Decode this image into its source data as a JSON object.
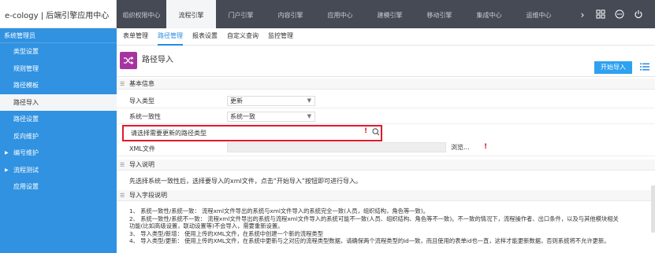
{
  "app": {
    "title": "e-cology | 后端引擎应用中心"
  },
  "top_tabs": [
    {
      "label": "组织权限中心",
      "active": false
    },
    {
      "label": "流程引擎",
      "active": true
    },
    {
      "label": "门户引擎",
      "active": false
    },
    {
      "label": "内容引擎",
      "active": false
    },
    {
      "label": "应用中心",
      "active": false
    },
    {
      "label": "建模引擎",
      "active": false
    },
    {
      "label": "移动引擎",
      "active": false
    },
    {
      "label": "集成中心",
      "active": false
    },
    {
      "label": "运维中心",
      "active": false
    }
  ],
  "top_icons": [
    "chevron-right-icon",
    "grid-icon",
    "dots-circle-icon",
    "power-icon"
  ],
  "sidebar": {
    "title": "系统管理员",
    "items": [
      {
        "label": "类型设置",
        "active": false,
        "expandable": false
      },
      {
        "label": "规则管理",
        "active": false,
        "expandable": false
      },
      {
        "label": "路径模板",
        "active": false,
        "expandable": false
      },
      {
        "label": "路径导入",
        "active": true,
        "expandable": false
      },
      {
        "label": "路径设置",
        "active": false,
        "expandable": false
      },
      {
        "label": "反向维护",
        "active": false,
        "expandable": false
      },
      {
        "label": "编号维护",
        "active": false,
        "expandable": true
      },
      {
        "label": "流程测试",
        "active": false,
        "expandable": true
      },
      {
        "label": "应用设置",
        "active": false,
        "expandable": false
      }
    ]
  },
  "subnav": [
    {
      "label": "表单管理",
      "active": false
    },
    {
      "label": "路径管理",
      "active": true
    },
    {
      "label": "报表设置",
      "active": false
    },
    {
      "label": "自定义查询",
      "active": false
    },
    {
      "label": "监控管理",
      "active": false
    }
  ],
  "page": {
    "title": "路径导入",
    "start_button": "开始导入"
  },
  "basic_info": {
    "header": "基本信息",
    "import_type": {
      "label": "导入类型",
      "value": "更新"
    },
    "consistency": {
      "label": "系统一致性",
      "value": "系统一致"
    },
    "path_type": {
      "label": "请选择需要更新的路径类型",
      "value": ""
    },
    "xml_file": {
      "label": "XML文件",
      "browse": "浏览..."
    }
  },
  "import_desc": {
    "header": "导入说明",
    "text": "先选择系统一致性后，选择要导入的xml文件，点击“开始导入”按钮即可进行导入。"
  },
  "field_desc": {
    "header": "导入字段说明",
    "lines": [
      "1、 系统一致性/系统一致： 流程xml文件导出的系统与xml文件导入的系统完全一致(人员，组织结构，角色等一致)。",
      "2、 系统一致性/系统不一致： 流程xml文件导出的系统与流程xml文件导入的系统可能不一致(人员、组织结构、角色等不一致)。不一致的情况下，流程操作者、出口条件，以及与其他模块相关",
      "功能(比如高级设置，联动设置等)不会导入，需要重新设置。",
      "3、 导入类型/新增： 使用上传的XML文件，在系统中创建一个新的流程类型",
      "4、 导入类型/更新： 使用上传的XML文件，在系统中更新与之对应的流程类型数据，请确保两个流程类型的id一致，而且使用的表单id也一直，这样才能更新数据，否则系统将不允许更新。"
    ]
  },
  "colors": {
    "topbar": "#454a55",
    "sidebar": "#3092e1",
    "accent": "#2b8ae0",
    "button": "#2ea1f0",
    "page_icon": "#a634a0",
    "required": "#e0192b"
  }
}
